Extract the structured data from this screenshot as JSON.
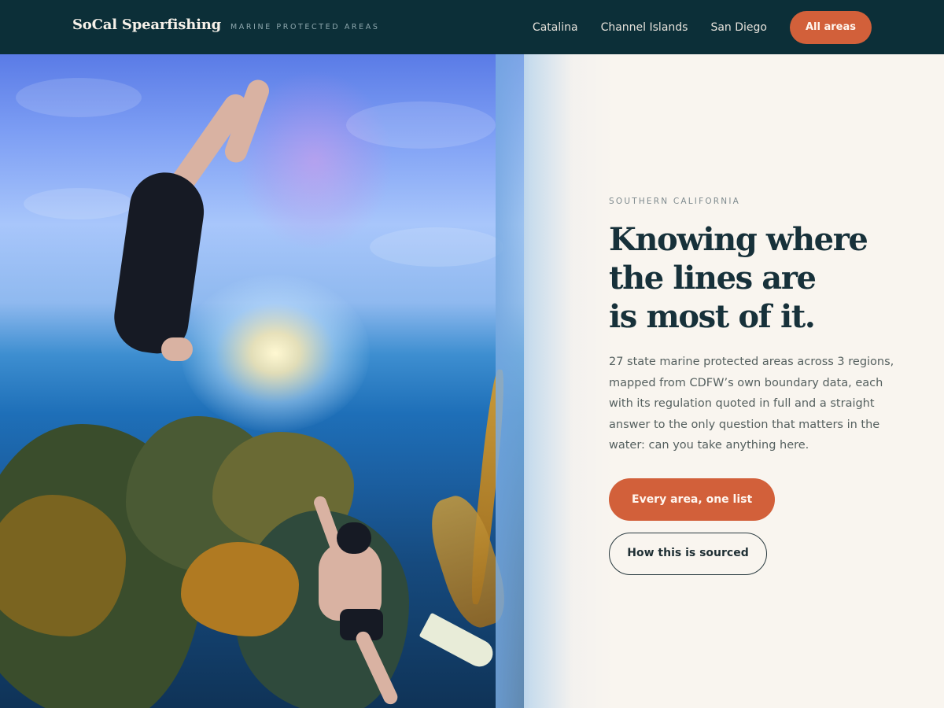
{
  "header": {
    "brand_name": "SoCal Spearfishing",
    "brand_tagline": "MARINE PROTECTED AREAS",
    "nav": [
      {
        "label": "Catalina"
      },
      {
        "label": "Channel Islands"
      },
      {
        "label": "San Diego"
      }
    ],
    "cta_label": "All areas"
  },
  "hero": {
    "eyebrow": "SOUTHERN CALIFORNIA",
    "headline": "Knowing where\nthe lines are\nis most of it.",
    "lede": "27 state marine protected areas across 3 regions, mapped from CDFW’s own boundary data, each with its regulation quoted in full and a straight answer to the only question that matters in the water: can you take anything here.",
    "primary_cta": "Every area, one list",
    "secondary_cta": "How this is sourced",
    "photo": "underwater-divers-photo"
  },
  "colors": {
    "header_bg": "#0c2f38",
    "accent": "#d2603a",
    "page_bg": "#f9f5ef",
    "headline": "#17313a"
  }
}
